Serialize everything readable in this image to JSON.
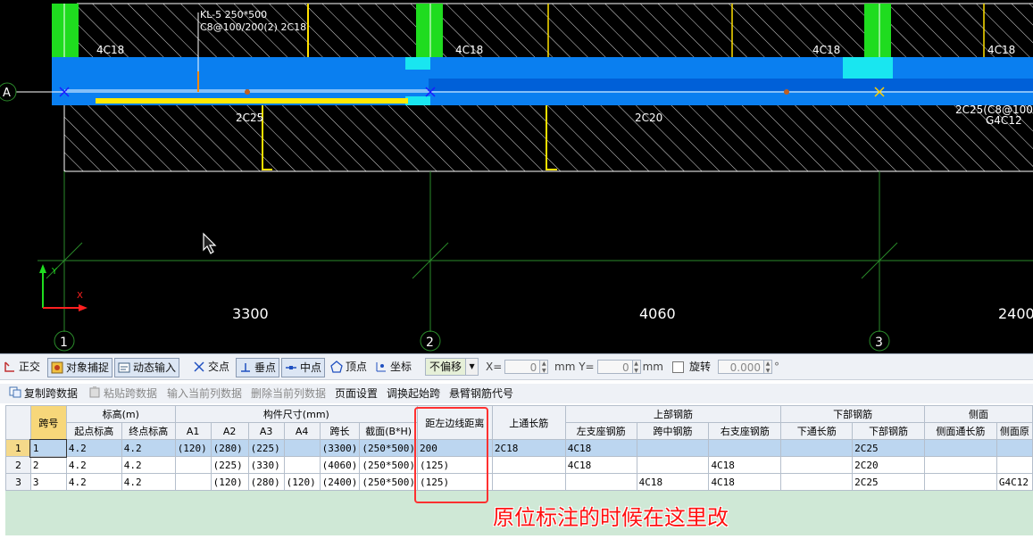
{
  "cad": {
    "beam_label_line1": "KL-5 250*500",
    "beam_label_line2": "C8@100/200(2) 2C18",
    "top_bar_left": "4C18",
    "top_bar_mid_left": "4C18",
    "top_bar_mid_right": "4C18",
    "top_bar_right": "4C18",
    "bottom_bar_span1": "2C25",
    "bottom_bar_span2": "2C20",
    "bottom_bar_span3_line1": "2C25(C8@100",
    "bottom_bar_span3_line2": "G4C12",
    "axis_letter": "A",
    "axis_1": "1",
    "axis_2": "2",
    "axis_3": "3",
    "dim_1": "3300",
    "dim_2": "4060",
    "dim_3": "2400",
    "ucs_y": "Y",
    "ucs_x": "X"
  },
  "snapbar": {
    "ortho": "正交",
    "object_snap": "对象捕捉",
    "dynamic_input": "动态输入",
    "intersection": "交点",
    "perpendicular": "垂点",
    "midpoint": "中点",
    "vertex": "顶点",
    "coordinate": "坐标",
    "offset_select": "不偏移",
    "x_label": "X=",
    "x_value": "0",
    "y_label": "mm Y=",
    "y_value": "0",
    "mm": "mm",
    "rotate_label": "旋转",
    "rotate_value": "0.000",
    "degree": "°"
  },
  "actbar": {
    "copy_span": "复制跨数据",
    "paste_span": "粘贴跨数据",
    "input_col": "输入当前列数据",
    "delete_col": "删除当前列数据",
    "page_setup": "页面设置",
    "swap_start": "调换起始跨",
    "cantilever_code": "悬臂钢筋代号"
  },
  "table": {
    "h_span": "跨号",
    "h_elev": "标高(m)",
    "h_size": "构件尺寸(mm)",
    "h_dist": "距左边线距离",
    "h_top_through": "上通长筋",
    "h_top_rebar": "上部钢筋",
    "h_bot_rebar": "下部钢筋",
    "h_side": "侧面",
    "h_start_elev": "起点标高",
    "h_end_elev": "终点标高",
    "h_a1": "A1",
    "h_a2": "A2",
    "h_a3": "A3",
    "h_a4": "A4",
    "h_span_len": "跨长",
    "h_section": "截面(B*H)",
    "h_left_support": "左支座钢筋",
    "h_mid_span": "跨中钢筋",
    "h_right_support": "右支座钢筋",
    "h_bot_through": "下通长筋",
    "h_bot_rebar2": "下部钢筋",
    "h_side_through": "侧面通长筋",
    "h_side2": "侧面原",
    "rows": [
      {
        "rn": "1",
        "span": "1",
        "start": "4.2",
        "end": "4.2",
        "a1": "(120)",
        "a2": "(280)",
        "a3": "(225)",
        "a4": "",
        "len": "(3300)",
        "sec": "(250*500)",
        "dist": "200",
        "top": "2C18",
        "left": "4C18",
        "mid": "",
        "right": "",
        "botthr": "",
        "bot": "2C25",
        "sidethr": "",
        "side": ""
      },
      {
        "rn": "2",
        "span": "2",
        "start": "4.2",
        "end": "4.2",
        "a1": "",
        "a2": "(225)",
        "a3": "(330)",
        "a4": "",
        "len": "(4060)",
        "sec": "(250*500)",
        "dist": "(125)",
        "top": "",
        "left": "4C18",
        "mid": "",
        "right": "4C18",
        "botthr": "",
        "bot": "2C20",
        "sidethr": "",
        "side": ""
      },
      {
        "rn": "3",
        "span": "3",
        "start": "4.2",
        "end": "4.2",
        "a1": "",
        "a2": "(120)",
        "a3": "(280)",
        "a4": "(120)",
        "len": "(2400)",
        "sec": "(250*500)",
        "dist": "(125)",
        "top": "",
        "left": "",
        "mid": "4C18",
        "right": "4C18",
        "botthr": "",
        "bot": "2C25",
        "sidethr": "",
        "side": "G4C12"
      }
    ]
  },
  "annotation": "原位标注的时候在这里改"
}
